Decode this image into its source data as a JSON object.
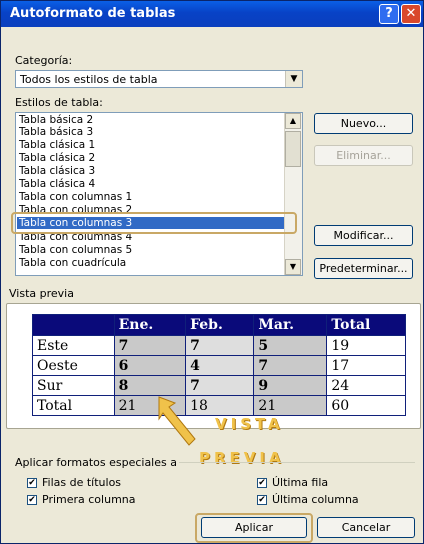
{
  "window": {
    "title": "Autoformato de tablas",
    "help_btn": "?",
    "close_btn": "✕"
  },
  "categoria": {
    "label": "Categoría:",
    "value": "Todos los estilos de tabla"
  },
  "estilos": {
    "label": "Estilos de tabla:",
    "items": [
      "Tabla básica 2",
      "Tabla básica 3",
      "Tabla clásica 1",
      "Tabla clásica 2",
      "Tabla clásica 3",
      "Tabla clásica 4",
      "Tabla con columnas 1",
      "Tabla con columnas 2",
      "Tabla con columnas 3",
      "Tabla con columnas 4",
      "Tabla con columnas 5",
      "Tabla con cuadrícula"
    ],
    "selected": "Tabla con columnas 3"
  },
  "buttons": {
    "nuevo": "Nuevo...",
    "eliminar": "Eliminar...",
    "modificar": "Modificar...",
    "predeterminar": "Predeterminar...",
    "aplicar": "Aplicar",
    "cancelar": "Cancelar"
  },
  "preview": {
    "label": "Vista previa",
    "header": [
      "",
      "Ene.",
      "Feb.",
      "Mar.",
      "Total"
    ],
    "rows": [
      [
        "Este",
        "7",
        "7",
        "5",
        "19"
      ],
      [
        "Oeste",
        "6",
        "4",
        "7",
        "17"
      ],
      [
        "Sur",
        "8",
        "7",
        "9",
        "24"
      ],
      [
        "Total",
        "21",
        "18",
        "21",
        "60"
      ]
    ]
  },
  "annotation": {
    "line1": "VISTA",
    "line2": "PREVIA"
  },
  "formatos": {
    "label": "Aplicar formatos especiales a",
    "filas_titulos": "Filas de títulos",
    "primera_columna": "Primera columna",
    "ultima_fila": "Última fila",
    "ultima_columna": "Última columna"
  },
  "colors": {
    "titlebar": "#0842c6",
    "selection": "#316ac5",
    "highlight": "#c9a865",
    "annotation": "#f0c24a"
  }
}
